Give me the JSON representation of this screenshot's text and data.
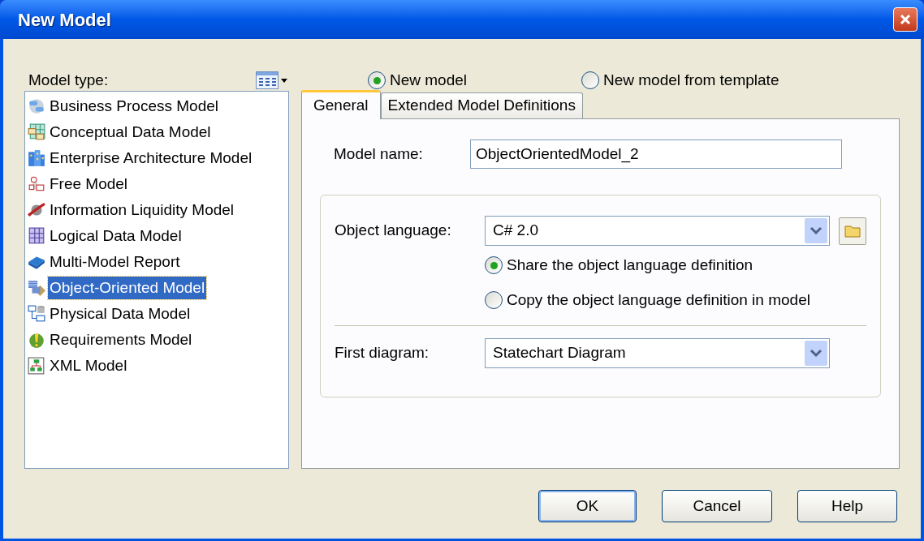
{
  "window": {
    "title": "New Model"
  },
  "model_type": {
    "label": "Model type:"
  },
  "model_types": [
    {
      "label": "Business Process Model",
      "kind": "process",
      "selected": false
    },
    {
      "label": "Conceptual Data Model",
      "kind": "conceptual",
      "selected": false
    },
    {
      "label": "Enterprise Architecture Model",
      "kind": "enterprise",
      "selected": false
    },
    {
      "label": "Free Model",
      "kind": "free",
      "selected": false
    },
    {
      "label": "Information Liquidity Model",
      "kind": "liquidity",
      "selected": false
    },
    {
      "label": "Logical Data Model",
      "kind": "logical",
      "selected": false
    },
    {
      "label": "Multi-Model Report",
      "kind": "report",
      "selected": false
    },
    {
      "label": "Object-Oriented Model",
      "kind": "object",
      "selected": true
    },
    {
      "label": "Physical Data Model",
      "kind": "physical",
      "selected": false
    },
    {
      "label": "Requirements Model",
      "kind": "requirements",
      "selected": false
    },
    {
      "label": "XML Model",
      "kind": "xml",
      "selected": false
    }
  ],
  "creation_mode": [
    {
      "label": "New model",
      "selected": true
    },
    {
      "label": "New model from template",
      "selected": false
    }
  ],
  "tabs": [
    {
      "label": "General",
      "selected": true
    },
    {
      "label": "Extended Model Definitions",
      "selected": false
    }
  ],
  "model_name": {
    "label": "Model name:",
    "value": "ObjectOrientedModel_2"
  },
  "object_language": {
    "label": "Object language:",
    "value": "C# 2.0"
  },
  "language_definition": [
    {
      "label": "Share the object language definition",
      "selected": true
    },
    {
      "label": "Copy the object language definition in model",
      "selected": false
    }
  ],
  "first_diagram": {
    "label": "First diagram:",
    "value": "Statechart Diagram"
  },
  "buttons": [
    {
      "label": "OK",
      "default": true
    },
    {
      "label": "Cancel",
      "default": false
    },
    {
      "label": "Help",
      "default": false
    }
  ]
}
